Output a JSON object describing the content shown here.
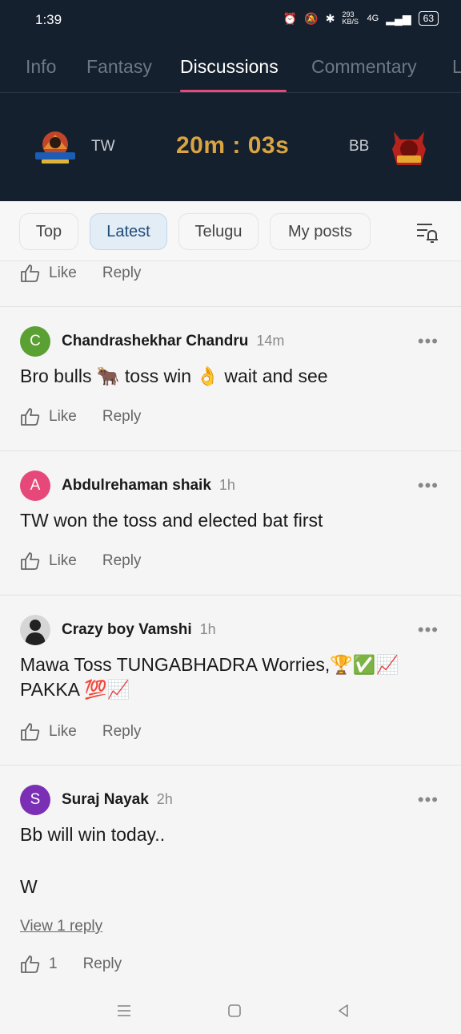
{
  "status": {
    "time": "1:39",
    "data_speed": "293 KB/S",
    "network": "4G",
    "battery": "63"
  },
  "tabs": [
    {
      "label": "Info"
    },
    {
      "label": "Fantasy"
    },
    {
      "label": "Discussions",
      "active": true
    },
    {
      "label": "Commentary"
    },
    {
      "label": "L"
    }
  ],
  "match": {
    "team_left": "TW",
    "team_left_logo_text": "TUNGABHADRA WARRIORS",
    "team_right": "BB",
    "team_right_logo_text": "BULLS",
    "countdown": "20m : 03s"
  },
  "filters": {
    "chips": [
      {
        "label": "Top"
      },
      {
        "label": "Latest",
        "active": true
      },
      {
        "label": "Telugu"
      },
      {
        "label": "My posts"
      }
    ]
  },
  "partial_post": {
    "like_label": "Like",
    "reply_label": "Reply"
  },
  "posts": [
    {
      "initial": "C",
      "avatar_color": "#5aa032",
      "author": "Chandrashekhar Chandru",
      "time": "14m",
      "text": "Bro bulls 🐂 toss win 👌 wait and see",
      "like_label": "Like",
      "reply_label": "Reply"
    },
    {
      "initial": "A",
      "avatar_color": "#e6487a",
      "author": "Abdulrehaman shaik",
      "time": "1h",
      "text": "TW won the toss and elected bat first",
      "like_label": "Like",
      "reply_label": "Reply"
    },
    {
      "initial": "",
      "avatar_color": "#d6d6d6",
      "author": "Crazy boy Vamshi",
      "time": "1h",
      "text": "Mawa Toss TUNGABHADRA Worries,🏆✅📈 PAKKA 💯📈",
      "like_label": "Like",
      "reply_label": "Reply"
    },
    {
      "initial": "S",
      "avatar_color": "#7b2fb4",
      "author": "Suraj Nayak",
      "time": "2h",
      "text_line1": "Bb will win  today..",
      "text_line2": "W",
      "view_replies": "View 1 reply",
      "like_count": "1",
      "reply_label": "Reply"
    }
  ],
  "more_glyph": "•••"
}
